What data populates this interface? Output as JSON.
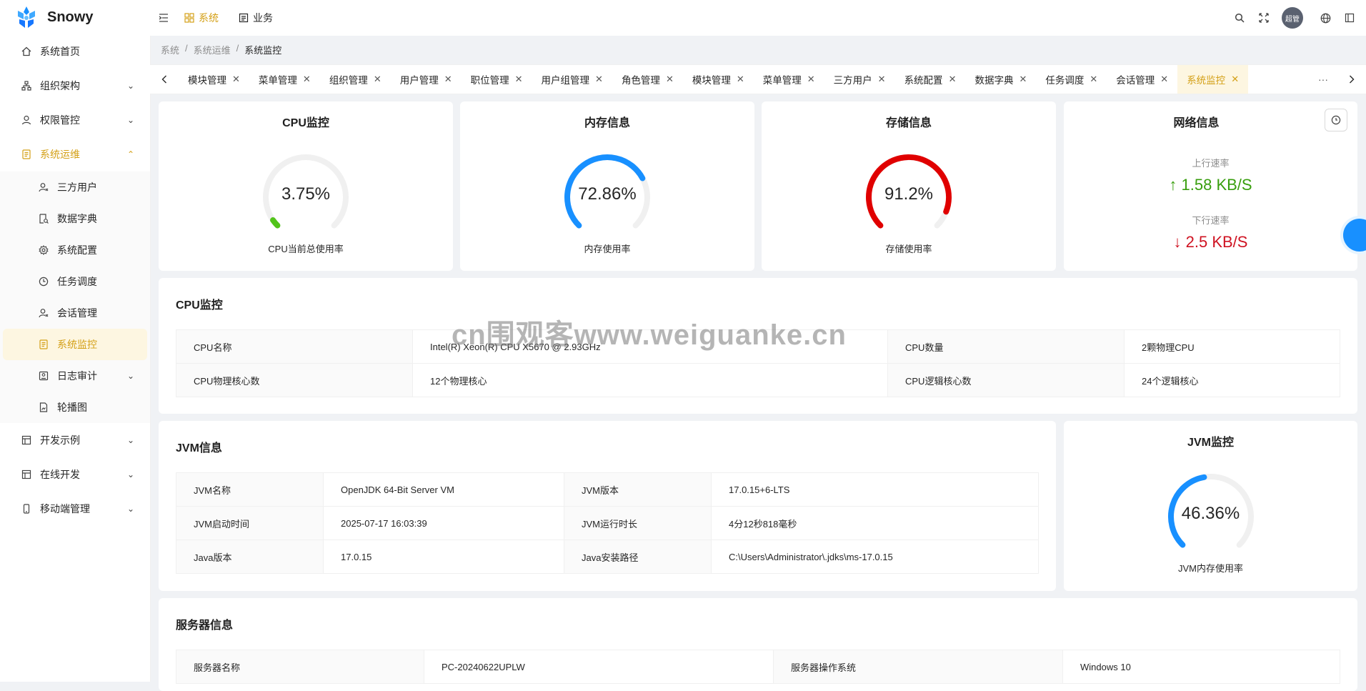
{
  "brand": {
    "name": "Snowy"
  },
  "sidebar": {
    "items": [
      {
        "label": "系统首页"
      },
      {
        "label": "组织架构"
      },
      {
        "label": "权限管控"
      },
      {
        "label": "系统运维"
      },
      {
        "label": "开发示例"
      },
      {
        "label": "在线开发"
      },
      {
        "label": "移动端管理"
      }
    ],
    "sub_items": [
      {
        "label": "三方用户"
      },
      {
        "label": "数据字典"
      },
      {
        "label": "系统配置"
      },
      {
        "label": "任务调度"
      },
      {
        "label": "会话管理"
      },
      {
        "label": "系统监控"
      },
      {
        "label": "日志审计"
      },
      {
        "label": "轮播图"
      }
    ]
  },
  "topbar": {
    "nav": [
      {
        "label": "系统"
      },
      {
        "label": "业务"
      }
    ],
    "avatar_text": "超管"
  },
  "breadcrumb": [
    "系统",
    "/",
    "系统运维",
    "/",
    "系统监控"
  ],
  "tabs": [
    "模块管理",
    "菜单管理",
    "组织管理",
    "用户管理",
    "职位管理",
    "用户组管理",
    "角色管理",
    "模块管理",
    "菜单管理",
    "三方用户",
    "系统配置",
    "数据字典",
    "任务调度",
    "会话管理",
    "系统监控"
  ],
  "tabs_more": "···",
  "cpu_card": {
    "title": "CPU监控",
    "value": "3.75%",
    "caption": "CPU当前总使用率",
    "percent": 3.75,
    "color": "#52c41a"
  },
  "mem_card": {
    "title": "内存信息",
    "value": "72.86%",
    "caption": "内存使用率",
    "percent": 72.86,
    "color": "#1890ff"
  },
  "disk_card": {
    "title": "存储信息",
    "value": "91.2%",
    "caption": "存储使用率",
    "percent": 91.2,
    "color": "#e00000"
  },
  "net_card": {
    "title": "网络信息",
    "up_label": "上行速率",
    "up_value": "1.58 KB/S",
    "down_label": "下行速率",
    "down_value": "2.5 KB/S"
  },
  "cpu_info": {
    "title": "CPU监控",
    "rows": [
      [
        "CPU名称",
        "Intel(R) Xeon(R) CPU X5670 @ 2.93GHz",
        "CPU数量",
        "2颗物理CPU"
      ],
      [
        "CPU物理核心数",
        "12个物理核心",
        "CPU逻辑核心数",
        "24个逻辑核心"
      ]
    ]
  },
  "jvm_info": {
    "title": "JVM信息",
    "rows": [
      [
        "JVM名称",
        "OpenJDK 64-Bit Server VM",
        "JVM版本",
        "17.0.15+6-LTS"
      ],
      [
        "JVM启动时间",
        "2025-07-17 16:03:39",
        "JVM运行时长",
        "4分12秒818毫秒"
      ],
      [
        "Java版本",
        "17.0.15",
        "Java安装路径",
        "C:\\Users\\Administrator\\.jdks\\ms-17.0.15"
      ]
    ]
  },
  "jvm_card": {
    "title": "JVM监控",
    "value": "46.36%",
    "caption": "JVM内存使用率",
    "percent": 46.36,
    "color": "#1890ff"
  },
  "server_info": {
    "title": "服务器信息",
    "rows": [
      [
        "服务器名称",
        "PC-20240622UPLW",
        "服务器操作系统",
        "Windows 10"
      ]
    ]
  },
  "watermark": "cn围观客www.weiguanke.cn"
}
